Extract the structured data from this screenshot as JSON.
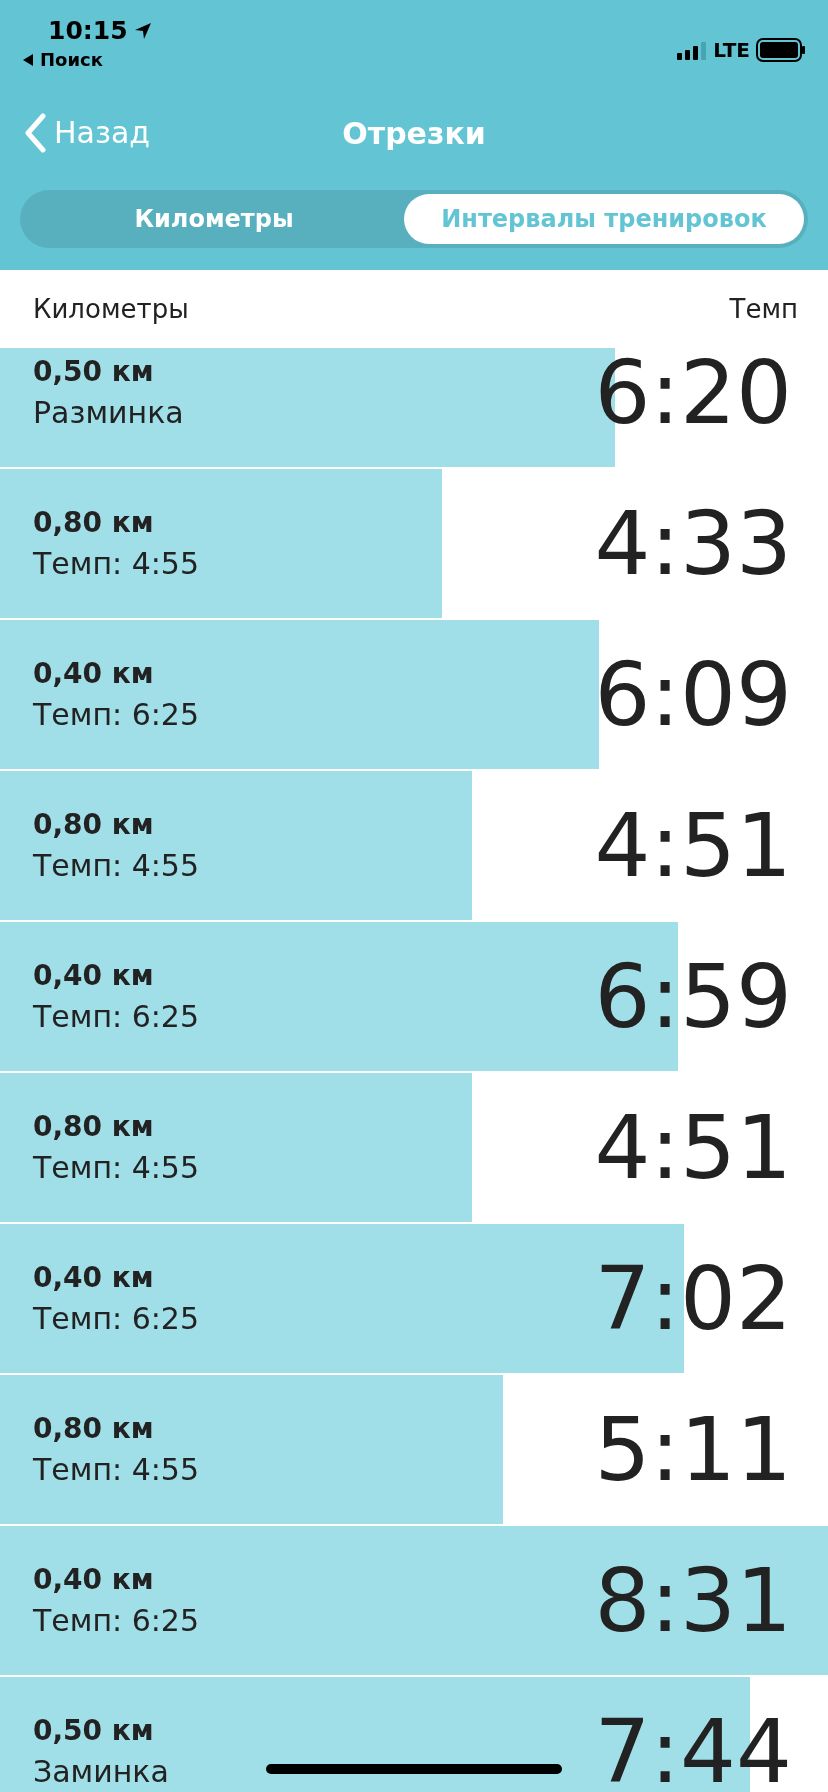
{
  "status_bar": {
    "time": "10:15",
    "back_app": "Поиск",
    "network": "LTE"
  },
  "nav": {
    "back": "Назад",
    "title": "Отрезки"
  },
  "tabs": [
    {
      "label": "Километры",
      "selected": false
    },
    {
      "label": "Интервалы тренировок",
      "selected": true
    }
  ],
  "columns": [
    "Километры",
    "Темп"
  ],
  "rows": [
    {
      "distance": "0,50 км",
      "note": "Разминка",
      "pace": "6:20",
      "level": 0.743
    },
    {
      "distance": "0,80 км",
      "note": "Темп: 4:55",
      "pace": "4:33",
      "level": 0.534
    },
    {
      "distance": "0,40 км",
      "note": "Темп: 6:25",
      "pace": "6:09",
      "level": 0.723
    },
    {
      "distance": "0,80 км",
      "note": "Темп: 4:55",
      "pace": "4:51",
      "level": 0.57
    },
    {
      "distance": "0,40 км",
      "note": "Темп: 6:25",
      "pace": "6:59",
      "level": 0.819
    },
    {
      "distance": "0,80 км",
      "note": "Темп: 4:55",
      "pace": "4:51",
      "level": 0.57
    },
    {
      "distance": "0,40 км",
      "note": "Темп: 6:25",
      "pace": "7:02",
      "level": 0.826
    },
    {
      "distance": "0,80 км",
      "note": "Темп: 4:55",
      "pace": "5:11",
      "level": 0.608
    },
    {
      "distance": "0,40 км",
      "note": "Темп: 6:25",
      "pace": "8:31",
      "level": 1.0
    },
    {
      "distance": "0,50 км",
      "note": "Заминка",
      "pace": "7:44",
      "level": 0.906
    }
  ]
}
